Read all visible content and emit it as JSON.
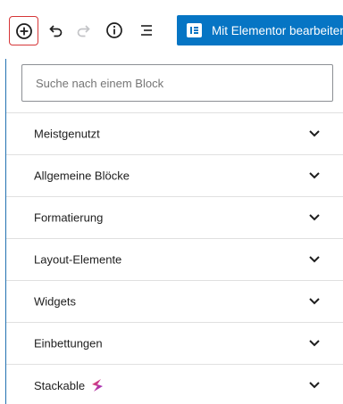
{
  "toolbar": {
    "icons": [
      "plus-circle-icon",
      "undo-icon",
      "redo-icon",
      "info-icon",
      "list-view-icon"
    ],
    "elementor_button_label": "Mit Elementor bearbeiten",
    "colors": {
      "accent": "#0675c4",
      "highlight": "#d63638",
      "panel_border": "#2271b1"
    }
  },
  "inserter": {
    "search_placeholder": "Suche nach einem Block",
    "panels": [
      {
        "label": "Meistgenutzt"
      },
      {
        "label": "Allgemeine Blöcke"
      },
      {
        "label": "Formatierung"
      },
      {
        "label": "Layout-Elemente"
      },
      {
        "label": "Widgets"
      },
      {
        "label": "Einbettungen"
      },
      {
        "label": "Stackable",
        "icon": "stackable-logo-icon"
      }
    ]
  }
}
